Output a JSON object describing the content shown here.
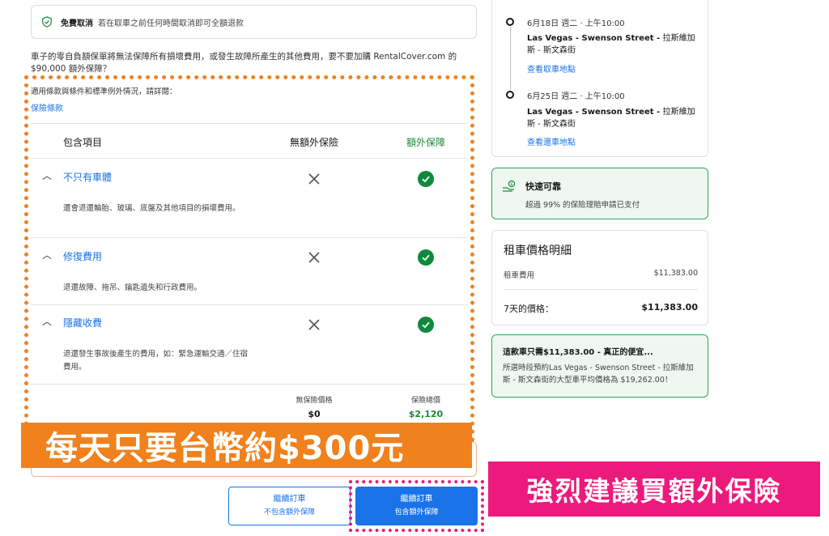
{
  "free_cancel": {
    "bold": "免費取消",
    "text": "若在取車之前任何時間取消即可全額退款"
  },
  "intro_text": "車子的零自負額保單將無法保障所有損壞費用，或發生故障所產生的其他費用，要不要加購 RentalCover.com 的 $90,000 額外保障？",
  "policy_note": "適用條款與條件和標準例外情況，請詳閱：",
  "policy_link": "保險條款",
  "table": {
    "col_included": "包含項目",
    "col_no_extra": "無額外保險",
    "col_extra": "額外保障",
    "rows": [
      {
        "title": "不只有車體",
        "desc": "還會退還輪胎、玻璃、底盤及其他項目的損壞費用。"
      },
      {
        "title": "修復費用",
        "desc": "退還故障、拖吊、鑰匙遺失和行政費用。"
      },
      {
        "title": "隱藏收費",
        "desc": "退還發生事故後產生的費用，如：緊急運輸交通／住宿費用。"
      }
    ],
    "no_insurance_price_label": "無保險價格",
    "no_insurance_price": "$0",
    "insurance_total_label": "保險總價",
    "insurance_total": "$2,120"
  },
  "orange_banner": "每天只要台幣約$300元",
  "pink_banner": "強烈建議買額外保險",
  "buttons": {
    "continue_without": {
      "label": "繼續訂車",
      "sub": "不包含額外保障"
    },
    "continue_with": {
      "label": "繼續訂車",
      "sub": "包含額外保障"
    }
  },
  "timeline": {
    "pickup": {
      "date": "6月18日 週二 · 上午10:00",
      "place_bold": "Las Vegas - Swenson Street - ",
      "place_rest": "拉斯維加斯 - 斯文森街",
      "link": "查看取車地點"
    },
    "dropoff": {
      "date": "6月25日 週二 · 上午10:00",
      "place_bold": "Las Vegas - Swenson Street - ",
      "place_rest": "拉斯維加斯 - 斯文森街",
      "link": "查看還車地點"
    }
  },
  "reliable": {
    "title": "快速可靠",
    "desc": "超過 99% 的保險理賠申請已支付"
  },
  "price_breakdown": {
    "title": "租車價格明細",
    "rental_label": "租車費用",
    "rental_value": "$11,383.00",
    "days_label": "7天的價格：",
    "days_value": "$11,383.00"
  },
  "deal": {
    "title": "這款車只需$11,383.00 - 真正的便宜...",
    "desc": "所選時段預約Las Vegas - Swenson Street - 拉斯維加斯 - 斯文森街的大型車平均價格為 $19,262.00！"
  },
  "colors": {
    "accent_blue": "#1a73e8",
    "green": "#0f8a3c",
    "orange": "#f0811c",
    "pink": "#ec1a7c"
  }
}
